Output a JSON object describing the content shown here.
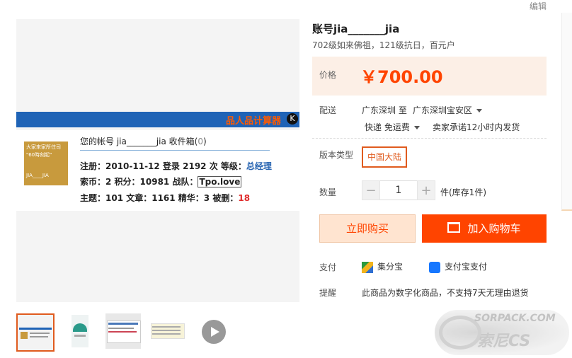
{
  "edit": "编辑",
  "gallery": {
    "card": {
      "brand": "品人品计算器",
      "brand_icon": "K",
      "avatar_text_1": "大家來家所住司",
      "avatar_text_2": "\"60時刻起\"",
      "avatar_text_3": "JIA____JIA",
      "title_prefix": "您的帐号 jia_______jia 收件箱(",
      "inbox_count": "0",
      "title_suffix": ")",
      "line1": "注册：2010-11-12 登录 2192 次 等级：",
      "level": "总经理",
      "line2": "索币：2 积分：10981 战队：",
      "team": "Tpo.love",
      "line3": "主题：101 文章：1161 精华：3 被删：",
      "deleted": "18"
    }
  },
  "product": {
    "title": "账号jia_______jia",
    "subtitle": "702级如来佛祖，121级抗日，百元户",
    "price_label": "价格",
    "price": "￥700.00",
    "shipping_label": "配送",
    "ship_from": "广东深圳 至",
    "ship_to": "广东深圳宝安区",
    "delivery_method": "快递 免运费",
    "delivery_promise": "卖家承诺12小时内发货",
    "version_label": "版本类型",
    "version_option": "中国大陆",
    "qty_label": "数量",
    "qty_minus": "−",
    "qty_value": "1",
    "qty_plus": "+",
    "stock": "件(库存1件)",
    "buy_now": "立即购买",
    "add_cart": "加入购物车",
    "pay_label": "支付",
    "pay_1": "集分宝",
    "pay_2": "支付宝支付",
    "notice_label": "提醒",
    "notice": "此商品为数字化商品，不支持7天无理由退货"
  },
  "watermark": {
    "line1": "SORPACK.COM",
    "line2": "索尼CS"
  },
  "colors": {
    "accent": "#ff4400",
    "selected_border": "#e05b1e"
  }
}
